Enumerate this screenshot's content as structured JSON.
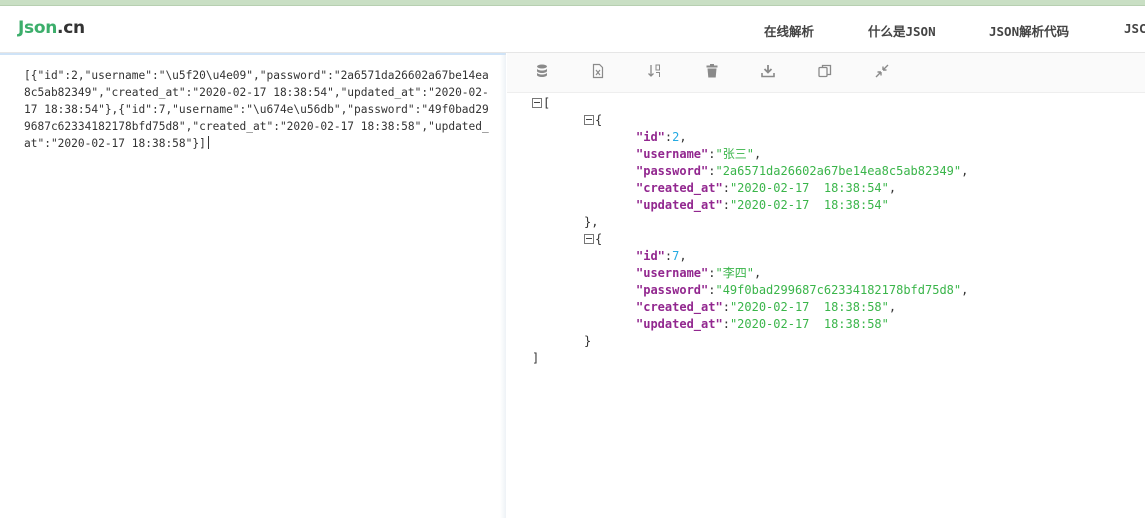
{
  "logo": {
    "part1": "Json",
    "part2": ".cn"
  },
  "nav": [
    {
      "label": "在线解析"
    },
    {
      "label": "什么是JSON"
    },
    {
      "label": "JSON解析代码"
    },
    {
      "label": "JSC"
    }
  ],
  "editor": {
    "raw_text": "[{\"id\":2,\"username\":\"\\u5f20\\u4e09\",\"password\":\"2a6571da26602a67be14ea8c5ab82349\",\"created_at\":\"2020-02-17 18:38:54\",\"updated_at\":\"2020-02-17 18:38:54\"},{\"id\":7,\"username\":\"\\u674e\\u56db\",\"password\":\"49f0bad299687c62334182178bfd75d8\",\"created_at\":\"2020-02-17 18:38:58\",\"updated_at\":\"2020-02-17 18:38:58\"}]"
  },
  "toolbar": {
    "icons": [
      "database-icon",
      "excel-icon",
      "sort-icon",
      "trash-icon",
      "download-icon",
      "copy-icon",
      "compress-icon"
    ]
  },
  "tree": {
    "open_bracket": "[",
    "close_bracket": "]",
    "open_brace": "{",
    "close_brace_comma": "},",
    "close_brace": "}",
    "records": [
      {
        "id": "2",
        "username": "\"张三\"",
        "password": "\"2a6571da26602a67be14ea8c5ab82349\"",
        "created_at": "\"2020-02-17  18:38:54\"",
        "updated_at": "\"2020-02-17  18:38:54\""
      },
      {
        "id": "7",
        "username": "\"李四\"",
        "password": "\"49f0bad299687c62334182178bfd75d8\"",
        "created_at": "\"2020-02-17  18:38:58\"",
        "updated_at": "\"2020-02-17  18:38:58\""
      }
    ],
    "keys": {
      "id": "\"id\"",
      "username": "\"username\"",
      "password": "\"password\"",
      "created_at": "\"created_at\"",
      "updated_at": "\"updated_at\""
    }
  },
  "colors": {
    "key": "#92278f",
    "number": "#25aae2",
    "string": "#3ab54a",
    "logo_green": "#3cae6b"
  }
}
